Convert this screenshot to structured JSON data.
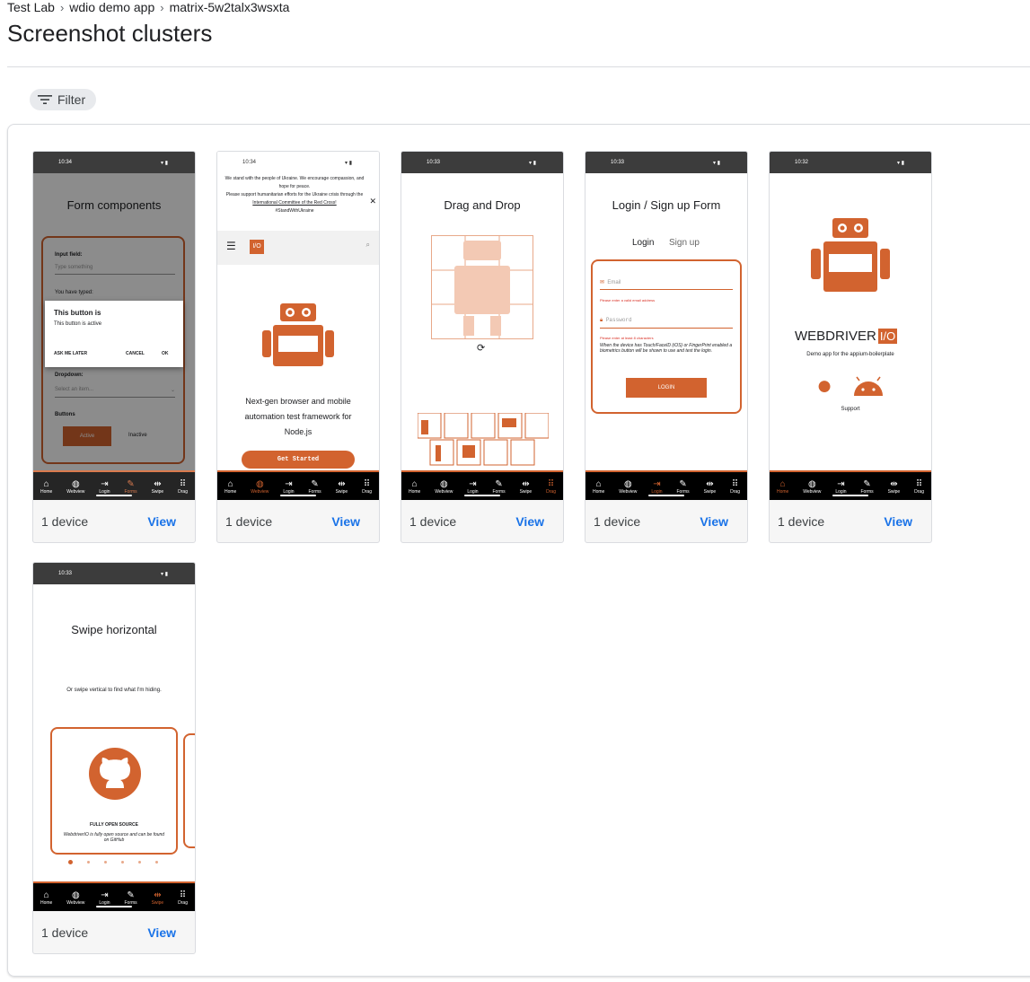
{
  "breadcrumb": [
    "Test Lab",
    "wdio demo app",
    "matrix-5w2talx3wsxta"
  ],
  "page_title": "Screenshot clusters",
  "filter_label": "Filter",
  "nav_labels": [
    "Home",
    "Webview",
    "Login",
    "Forms",
    "Swipe",
    "Drag"
  ],
  "cards": [
    {
      "time": "10:34",
      "device_count": "1 device",
      "view_label": "View",
      "heading": "Form components",
      "input_label": "Input field:",
      "input_placeholder": "Type something",
      "typed_label": "You have typed:",
      "dialog_title": "This button is",
      "dialog_message": "This button is active",
      "dialog_later": "ASK ME LATER",
      "dialog_cancel": "CANCEL",
      "dialog_ok": "OK",
      "dropdown_label": "Dropdown:",
      "dropdown_placeholder": "Select an item...",
      "buttons_label": "Buttons",
      "active_label": "Active",
      "inactive_label": "Inactive"
    },
    {
      "time": "10:34",
      "device_count": "1 device",
      "view_label": "View",
      "banner_line1": "We stand with the people of Ukraine. We encourage compassion, and hope for peace.",
      "banner_line2": "Please support humanitarian efforts for the Ukraine crisis through the",
      "banner_link": "International Committee of the Red Cross!",
      "banner_tag": "#StandWithUkraine",
      "logo_text": "I/O",
      "tagline": "Next-gen browser and mobile automation test framework for Node.js",
      "cta": "Get Started"
    },
    {
      "time": "10:33",
      "device_count": "1 device",
      "view_label": "View",
      "heading": "Drag and Drop"
    },
    {
      "time": "10:33",
      "device_count": "1 device",
      "view_label": "View",
      "heading": "Login / Sign up Form",
      "tab_login": "Login",
      "tab_signup": "Sign up",
      "email_placeholder": "Email",
      "email_error": "Please enter a valid email address",
      "password_placeholder": "Password",
      "password_error": "Please enter at least 8 characters",
      "biometric_note": "When the device has Touch/FaceID (iOS) or FingerPrint enabled a biometrics button will be shown to use and test the login.",
      "login_button": "LOGIN"
    },
    {
      "time": "10:32",
      "device_count": "1 device",
      "view_label": "View",
      "brand": "WEBDRIVER",
      "brand_io": "I/O",
      "subtitle": "Demo app for the appium-boilerplate",
      "support": "Support"
    },
    {
      "time": "10:33",
      "device_count": "1 device",
      "view_label": "View",
      "heading": "Swipe horizontal",
      "hint": "Or swipe vertical to find what I'm hiding.",
      "card_title": "FULLY OPEN SOURCE",
      "card_text": "WebdriverIO is fully open source and can be found on GitHub"
    }
  ],
  "colors": {
    "accent": "#d2632f",
    "link": "#1a73e8",
    "status_bar": "#3c3c3c"
  }
}
